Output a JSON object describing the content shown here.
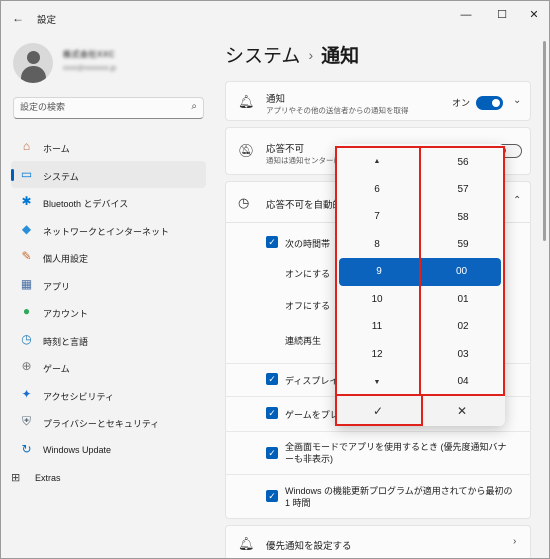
{
  "window": {
    "title": "設定",
    "back_icon": "←",
    "min_icon": "—",
    "max_icon": "☐",
    "close_icon": "✕"
  },
  "user": {
    "name": "株式会社XXC",
    "email": "xxxx@xxxxxxx.jp"
  },
  "search": {
    "placeholder": "設定の検索",
    "icon": "⌕"
  },
  "sidebar": {
    "items": [
      {
        "label": "ホーム",
        "icon": "⌂",
        "color": "#c06a3a"
      },
      {
        "label": "システム",
        "icon": "▭",
        "color": "#0078d4",
        "selected": true
      },
      {
        "label": "Bluetooth とデバイス",
        "icon": "✱",
        "color": "#0078d4"
      },
      {
        "label": "ネットワークとインターネット",
        "icon": "◆",
        "color": "#2a8fd6"
      },
      {
        "label": "個人用設定",
        "icon": "✎",
        "color": "#c86a2e"
      },
      {
        "label": "アプリ",
        "icon": "▦",
        "color": "#4a6fa5"
      },
      {
        "label": "アカウント",
        "icon": "●",
        "color": "#2ea85a"
      },
      {
        "label": "時刻と言語",
        "icon": "◷",
        "color": "#1f7ab8"
      },
      {
        "label": "ゲーム",
        "icon": "⊕",
        "color": "#777777"
      },
      {
        "label": "アクセシビリティ",
        "icon": "✦",
        "color": "#1f6fd1"
      },
      {
        "label": "プライバシーとセキュリティ",
        "icon": "⛨",
        "color": "#5c6b7a"
      },
      {
        "label": "Windows Update",
        "icon": "↻",
        "color": "#0a6fc2"
      }
    ],
    "extras": {
      "label": "Extras",
      "icon": "⊞"
    }
  },
  "breadcrumb": {
    "parent": "システム",
    "separator": "›",
    "current": "通知"
  },
  "notifications": {
    "title": "通知",
    "subtitle": "アプリやその他の送信者からの通知を取得",
    "toggle_label": "オン",
    "toggle_on": true,
    "icon": "🔔"
  },
  "dnd": {
    "title": "応答不可",
    "subtitle": "通知は通知センターに",
    "toggle_on": false
  },
  "auto_dnd": {
    "title": "応答不可を自動的",
    "time_checkbox": "次の時間帯",
    "on_label": "オンにする",
    "off_label": "オフにする",
    "repeat_label": "連続再生",
    "display_checkbox": "ディスプレイを",
    "game_checkbox": "ゲームをプレイ",
    "fullscreen_checkbox": "全画面モードでアプリを使用するとき (優先度通知バナーも非表示)",
    "update_checkbox": "Windows の機能更新プログラムが適用されてから最初の 1 時間"
  },
  "priority": {
    "title": "優先通知を設定する"
  },
  "time_picker": {
    "hours_above": [
      "6",
      "7",
      "8"
    ],
    "hour_selected": "9",
    "hours_below": [
      "10",
      "11",
      "12"
    ],
    "minutes_above": [
      "56",
      "57",
      "58",
      "59"
    ],
    "minute_selected": "00",
    "minutes_below": [
      "01",
      "02",
      "03",
      "04"
    ],
    "up_arrow": "▲",
    "down_arrow": "▼",
    "accept_icon": "✓",
    "cancel_icon": "✕"
  },
  "accent_color": "#005fb8",
  "highlight_color": "#e0201b"
}
